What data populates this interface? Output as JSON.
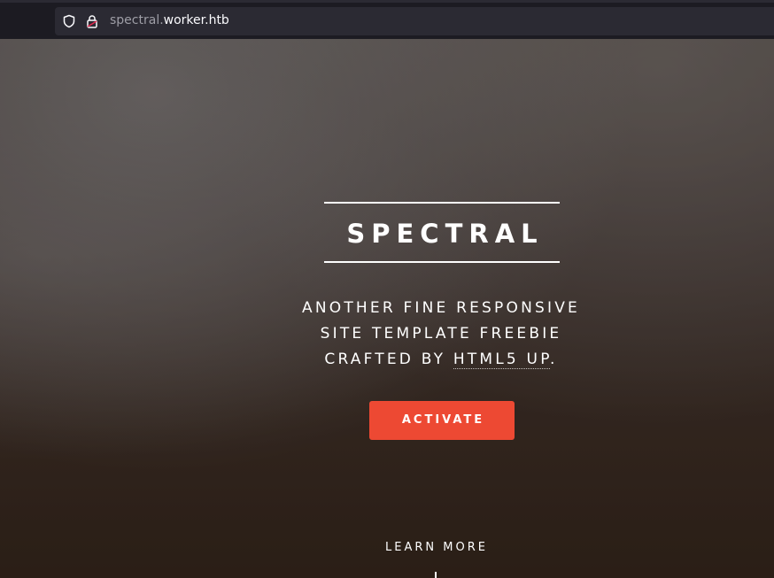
{
  "browser": {
    "url_subdomain": "spectral.",
    "url_domain": "worker.htb",
    "icons": [
      "shield-icon",
      "lock-icon"
    ]
  },
  "hero": {
    "title": "SPECTRAL",
    "tagline_line1": "ANOTHER FINE RESPONSIVE",
    "tagline_line2": "SITE TEMPLATE FREEBIE",
    "tagline_line3_prefix": "CRAFTED BY ",
    "tagline_link": "HTML5 UP",
    "tagline_line3_suffix": ".",
    "button_label": "ACTIVATE",
    "learn_more": "LEARN MORE"
  },
  "colors": {
    "accent": "#ed4933",
    "text": "#ffffff",
    "browser_bg": "#1c1b22",
    "url_bar_bg": "#2b2a33"
  }
}
